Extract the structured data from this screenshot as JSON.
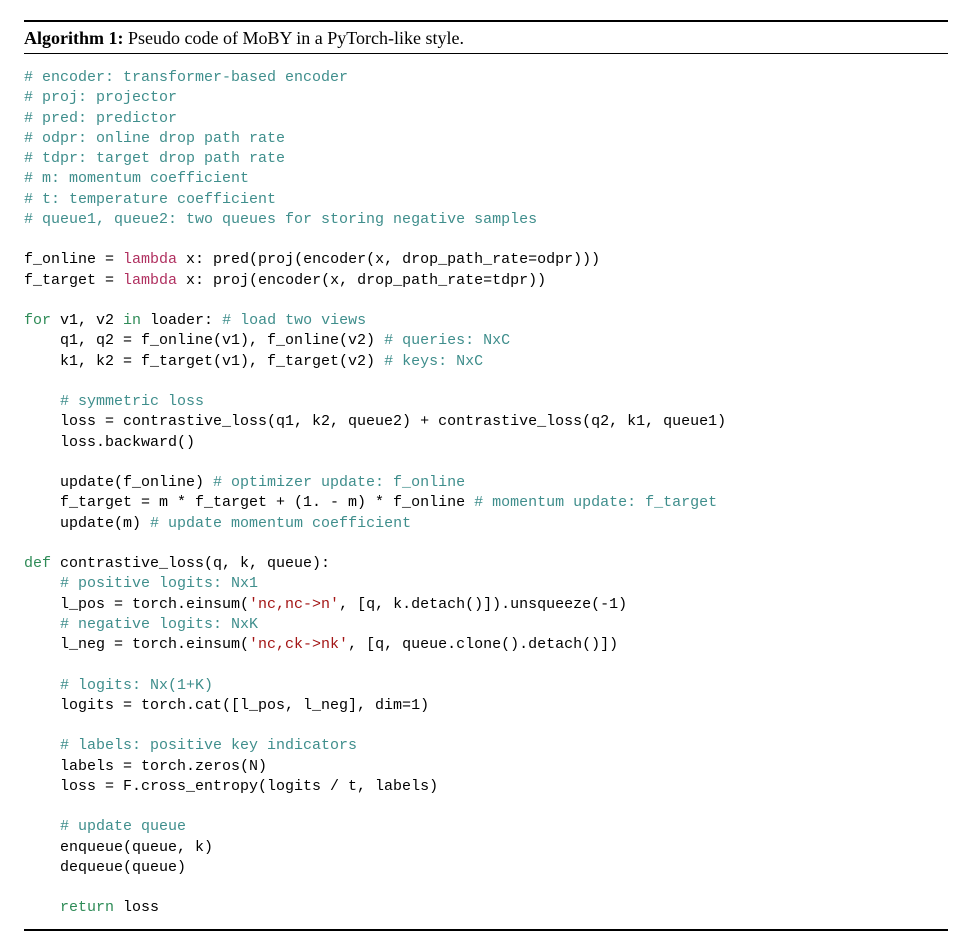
{
  "title": {
    "label": "Algorithm 1:",
    "caption": "Pseudo code of MoBY in a PyTorch-like style."
  },
  "code": {
    "c_encoder": "# encoder: transformer-based encoder",
    "c_proj": "# proj: projector",
    "c_pred": "# pred: predictor",
    "c_odpr": "# odpr: online drop path rate",
    "c_tdpr": "# tdpr: target drop path rate",
    "c_m": "# m: momentum coefficient",
    "c_t": "# t: temperature coefficient",
    "c_queue": "# queue1, queue2: two queues for storing negative samples",
    "f_online_lhs": "f_online = ",
    "lambda": "lambda",
    "f_online_rhs": " x: pred(proj(encoder(x, drop_path_rate=odpr)))",
    "f_target_lhs": "f_target = ",
    "f_target_rhs": " x: proj(encoder(x, drop_path_rate=tdpr))",
    "for": "for",
    "for_vars": " v1, v2 ",
    "in": "in",
    "for_rest": " loader: ",
    "c_loadviews": "# load two views",
    "q_line": "    q1, q2 = f_online(v1), f_online(v2) ",
    "c_queries": "# queries: NxC",
    "k_line": "    k1, k2 = f_target(v1), f_target(v2) ",
    "c_keys": "# keys: NxC",
    "c_symloss": "    # symmetric loss",
    "loss_line": "    loss = contrastive_loss(q1, k2, queue2) + contrastive_loss(q2, k1, queue1)",
    "backward": "    loss.backward()",
    "update_online": "    update(f_online) ",
    "c_optupdate": "# optimizer update: f_online",
    "momentum_line": "    f_target = m * f_target + (1. - m) * f_online ",
    "c_momupdate": "# momentum update: f_target",
    "update_m": "    update(m) ",
    "c_updatem": "# update momentum coefficient",
    "def": "def",
    "def_sig": " contrastive_loss(q, k, queue):",
    "c_poslogits": "    # positive logits: Nx1",
    "lpos_a": "    l_pos = torch.einsum(",
    "s_nc_n": "'nc,nc->n'",
    "lpos_b": ", [q, k.detach()]).unsqueeze(-1)",
    "c_neglogits": "    # negative logits: NxK",
    "lneg_a": "    l_neg = torch.einsum(",
    "s_nc_ck": "'nc,ck->nk'",
    "lneg_b": ", [q, queue.clone().detach()])",
    "c_logits": "    # logits: Nx(1+K)",
    "logits_line": "    logits = torch.cat([l_pos, l_neg], dim=1)",
    "c_labels": "    # labels: positive key indicators",
    "labels_line": "    labels = torch.zeros(N)",
    "ce_line": "    loss = F.cross_entropy(logits / t, labels)",
    "c_upqueue": "    # update queue",
    "enqueue": "    enqueue(queue, k)",
    "dequeue": "    dequeue(queue)",
    "return": "return",
    "return_rest": " loss",
    "return_indent": "    "
  }
}
